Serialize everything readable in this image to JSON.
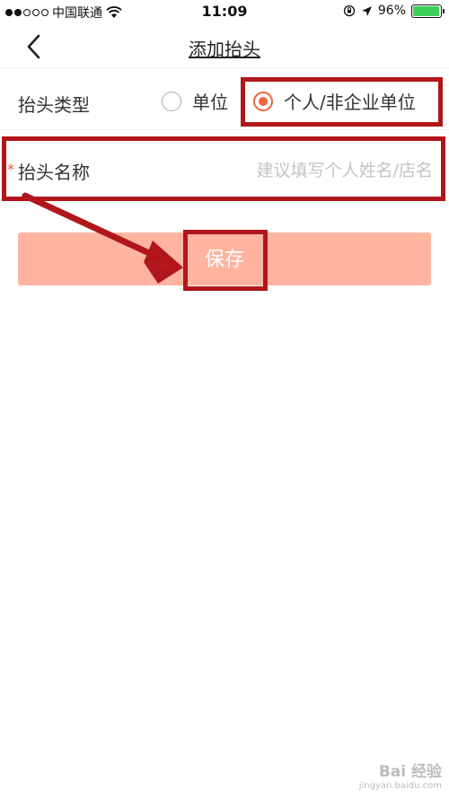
{
  "status_bar": {
    "carrier": "中国联通",
    "time": "11:09",
    "battery": "96%",
    "battery_level": 0.96
  },
  "nav": {
    "title": "添加抬头",
    "back_icon": "chevron-left-icon"
  },
  "form": {
    "type_label": "抬头类型",
    "options": [
      {
        "label": "单位",
        "checked": false
      },
      {
        "label": "个人/非企业单位",
        "checked": true
      }
    ],
    "required_mark": "*",
    "name_label": "抬头名称",
    "name_placeholder": "建议填写个人姓名/店名",
    "name_value": ""
  },
  "save_label": "保存",
  "colors": {
    "accent": "#f0643c",
    "save_button": "#ffb4a0",
    "annotation": "#b0161a"
  },
  "watermark": {
    "logo": "Bai 经验",
    "site": "jingyan.baidu.com"
  }
}
